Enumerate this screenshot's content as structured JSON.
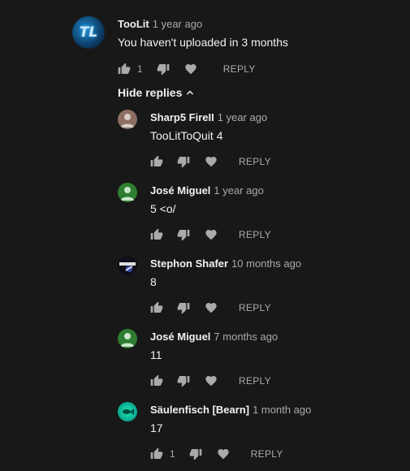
{
  "thread": {
    "top": {
      "author": "TooLit",
      "time": "1 year ago",
      "text": "You haven't uploaded in 3 months",
      "likes": "1",
      "reply_label": "REPLY",
      "avatar_text": "TL",
      "avatar_color": "#0d4a7a"
    },
    "hide_replies_label": "Hide replies",
    "replies": [
      {
        "author": "Sharp5 FireII",
        "time": "1 year ago",
        "text": "TooLitToQuit 4",
        "likes": "",
        "reply_label": "REPLY",
        "avatar_color": "#8d6e63"
      },
      {
        "author": "José Miguel",
        "time": "1 year ago",
        "text": "5 <o/",
        "likes": "",
        "reply_label": "REPLY",
        "avatar_color": "#2e7d32"
      },
      {
        "author": "Stephon Shafer",
        "time": "10 months ago",
        "text": "8",
        "likes": "",
        "reply_label": "REPLY",
        "avatar_color": "#1a1a2e"
      },
      {
        "author": "José Miguel",
        "time": "7 months ago",
        "text": "11",
        "likes": "",
        "reply_label": "REPLY",
        "avatar_color": "#2e7d32"
      },
      {
        "author": "Säulenfisch [Bearn]",
        "time": "1 month ago",
        "text": "17",
        "likes": "1",
        "reply_label": "REPLY",
        "avatar_color": "#26a69a"
      }
    ]
  },
  "icons": {
    "like": "thumbs-up-icon",
    "dislike": "thumbs-down-icon",
    "heart": "heart-icon",
    "chevron": "chevron-up-icon"
  },
  "colors": {
    "background": "#181818",
    "text_primary": "#f1f1f1",
    "text_secondary": "#aaaaaa",
    "icon": "#aaaaaa"
  }
}
